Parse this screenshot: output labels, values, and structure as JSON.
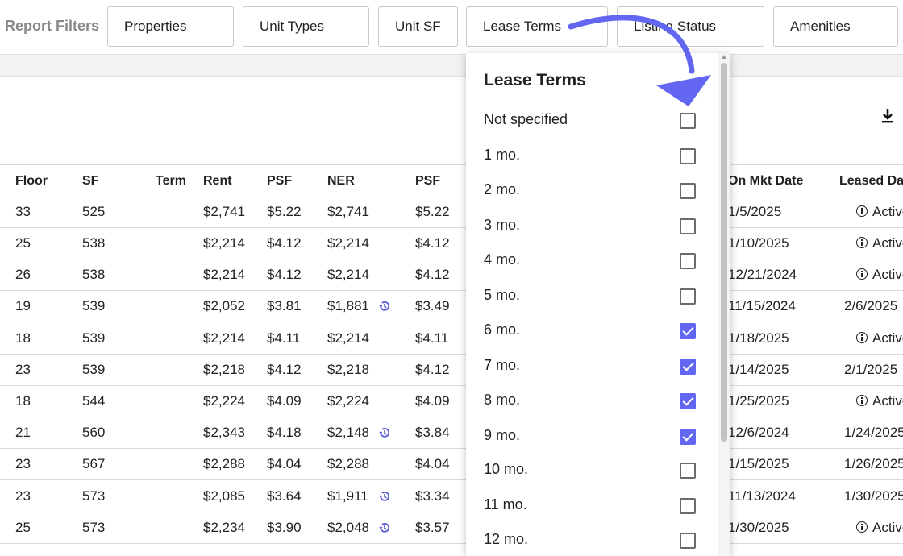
{
  "filter_bar": {
    "title": "Report Filters",
    "buttons": [
      "Properties",
      "Unit Types",
      "Unit SF",
      "Lease Terms",
      "Listing Status",
      "Amenities"
    ]
  },
  "table": {
    "headers": [
      "Floor",
      "SF",
      "Term",
      "Rent",
      "PSF",
      "NER",
      "PSF",
      "On Mkt Date",
      "Leased Date"
    ],
    "rows": [
      {
        "floor": "33",
        "sf": "525",
        "rent": "$2,741",
        "psf": "$5.22",
        "ner": "$2,741",
        "ner_psf": "$5.22",
        "on_mkt": "1/5/2025",
        "leased": "Active",
        "active": true,
        "history": false
      },
      {
        "floor": "25",
        "sf": "538",
        "rent": "$2,214",
        "psf": "$4.12",
        "ner": "$2,214",
        "ner_psf": "$4.12",
        "on_mkt": "1/10/2025",
        "leased": "Active",
        "active": true,
        "history": false
      },
      {
        "floor": "26",
        "sf": "538",
        "rent": "$2,214",
        "psf": "$4.12",
        "ner": "$2,214",
        "ner_psf": "$4.12",
        "on_mkt": "12/21/2024",
        "leased": "Active",
        "active": true,
        "history": false
      },
      {
        "floor": "19",
        "sf": "539",
        "rent": "$2,052",
        "psf": "$3.81",
        "ner": "$1,881",
        "ner_psf": "$3.49",
        "on_mkt": "11/15/2024",
        "leased": "2/6/2025",
        "active": false,
        "history": true
      },
      {
        "floor": "18",
        "sf": "539",
        "rent": "$2,214",
        "psf": "$4.11",
        "ner": "$2,214",
        "ner_psf": "$4.11",
        "on_mkt": "1/18/2025",
        "leased": "Active",
        "active": true,
        "history": false
      },
      {
        "floor": "23",
        "sf": "539",
        "rent": "$2,218",
        "psf": "$4.12",
        "ner": "$2,218",
        "ner_psf": "$4.12",
        "on_mkt": "1/14/2025",
        "leased": "2/1/2025",
        "active": false,
        "history": false
      },
      {
        "floor": "18",
        "sf": "544",
        "rent": "$2,224",
        "psf": "$4.09",
        "ner": "$2,224",
        "ner_psf": "$4.09",
        "on_mkt": "1/25/2025",
        "leased": "Active",
        "active": true,
        "history": false
      },
      {
        "floor": "21",
        "sf": "560",
        "rent": "$2,343",
        "psf": "$4.18",
        "ner": "$2,148",
        "ner_psf": "$3.84",
        "on_mkt": "12/6/2024",
        "leased": "1/24/2025",
        "active": false,
        "history": true
      },
      {
        "floor": "23",
        "sf": "567",
        "rent": "$2,288",
        "psf": "$4.04",
        "ner": "$2,288",
        "ner_psf": "$4.04",
        "on_mkt": "1/15/2025",
        "leased": "1/26/2025",
        "active": false,
        "history": false
      },
      {
        "floor": "23",
        "sf": "573",
        "rent": "$2,085",
        "psf": "$3.64",
        "ner": "$1,911",
        "ner_psf": "$3.34",
        "on_mkt": "11/13/2024",
        "leased": "1/30/2025",
        "active": false,
        "history": true
      },
      {
        "floor": "25",
        "sf": "573",
        "rent": "$2,234",
        "psf": "$3.90",
        "ner": "$2,048",
        "ner_psf": "$3.57",
        "on_mkt": "1/30/2025",
        "leased": "Active",
        "active": true,
        "history": true
      }
    ]
  },
  "lease_terms_dropdown": {
    "title": "Lease Terms",
    "options": [
      {
        "label": "Not specified",
        "checked": false
      },
      {
        "label": "1 mo.",
        "checked": false
      },
      {
        "label": "2 mo.",
        "checked": false
      },
      {
        "label": "3 mo.",
        "checked": false
      },
      {
        "label": "4 mo.",
        "checked": false
      },
      {
        "label": "5 mo.",
        "checked": false
      },
      {
        "label": "6 mo.",
        "checked": true
      },
      {
        "label": "7 mo.",
        "checked": true
      },
      {
        "label": "8 mo.",
        "checked": true
      },
      {
        "label": "9 mo.",
        "checked": true
      },
      {
        "label": "10 mo.",
        "checked": false
      },
      {
        "label": "11 mo.",
        "checked": false
      },
      {
        "label": "12 mo.",
        "checked": false
      }
    ]
  },
  "icons": {
    "download": "download-icon",
    "history": "history-icon",
    "info": "info-icon",
    "annotation_arrow": "curved-arrow-annotation"
  },
  "colors": {
    "accent": "#6366f1",
    "history_icon": "#5b5bd6"
  }
}
